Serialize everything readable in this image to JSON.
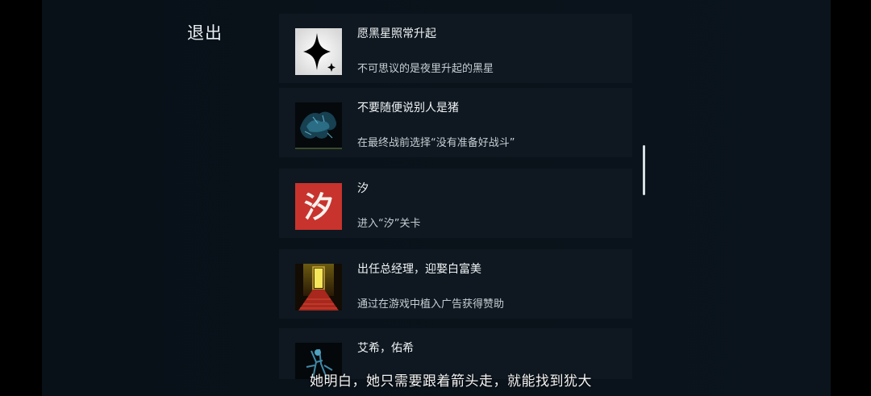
{
  "exit": {
    "label": "退出"
  },
  "achievements": [
    {
      "title": "愿黑星照常升起",
      "description": "不可思议的是夜里升起的黑星",
      "icon": "black-star-icon"
    },
    {
      "title": "不要随便说别人是猪",
      "description": "在最终战前选择“没有准备好战斗”",
      "icon": "spectral-beast-icon"
    },
    {
      "title": "汐",
      "description": "进入“汐”关卡",
      "icon": "xi-character-icon",
      "icon_text": "汐"
    },
    {
      "title": "出任总经理，迎娶白富美",
      "description": "通过在游戏中植入广告获得赞助",
      "icon": "golden-doorway-icon"
    },
    {
      "title": "艾希，佑希",
      "description": "",
      "icon": "blue-figure-icon"
    }
  ],
  "subtitle": {
    "text": "她明白，她只需要跟着箭头走，就能找到犹大"
  },
  "colors": {
    "background": "#0b141c",
    "card": "#0f1820",
    "xi_red": "#c8332d",
    "title_text": "#f0f4f6",
    "desc_text": "#c5ced4"
  }
}
